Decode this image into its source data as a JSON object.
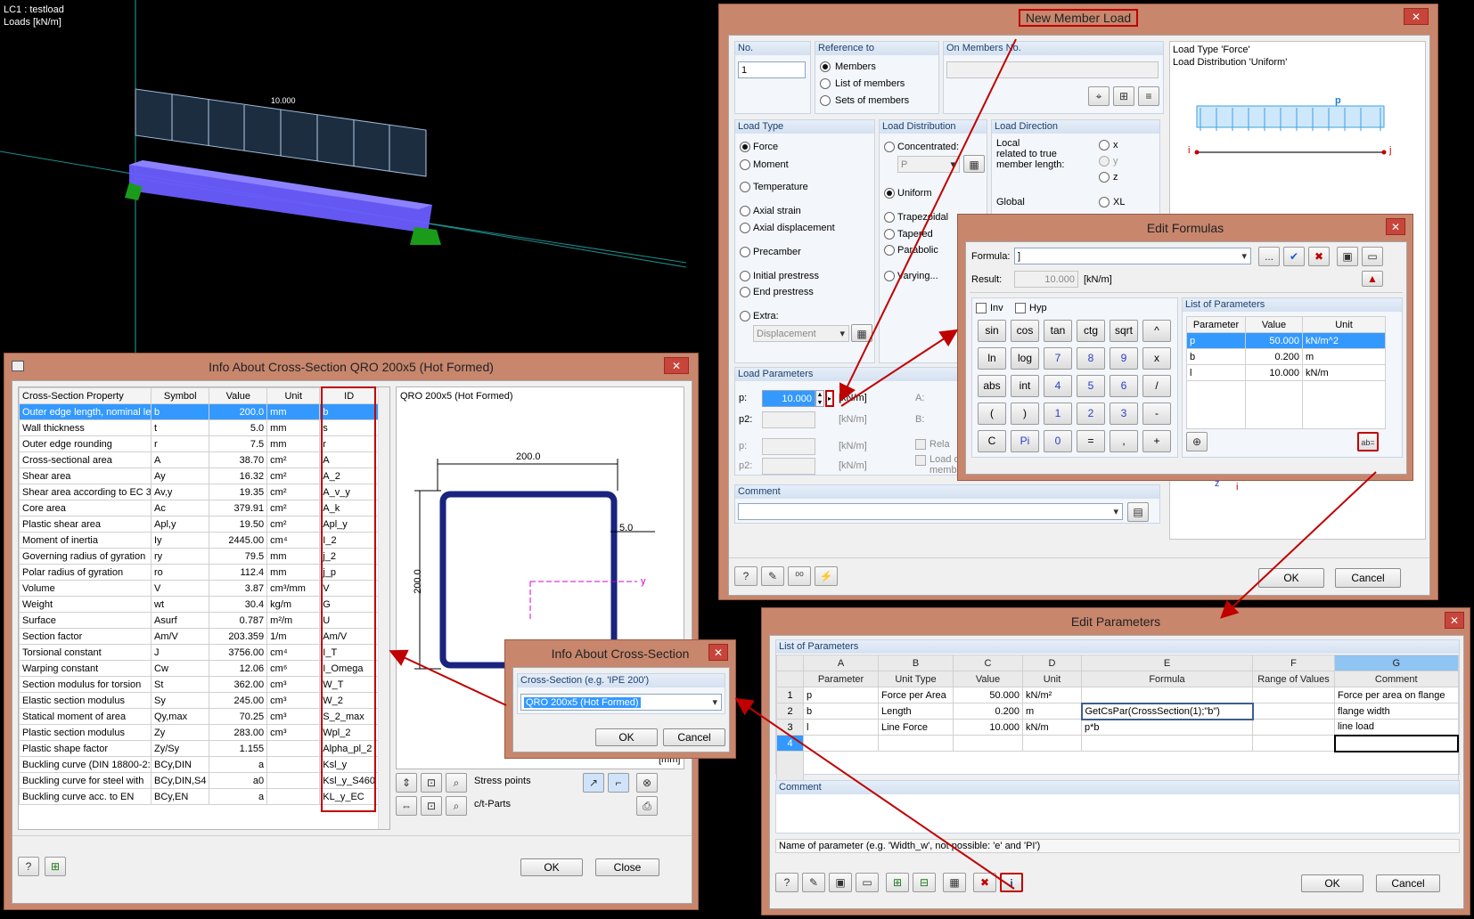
{
  "viewport": {
    "lc_title": "LC1 : testload",
    "loads_label": "Loads [kN/m]",
    "load_value": "10.000"
  },
  "new_member_load": {
    "title": "New Member Load",
    "no_label": "No.",
    "no_value": "1",
    "reference_label": "Reference to",
    "reference_options": [
      "Members",
      "List of members",
      "Sets of members"
    ],
    "on_members_label": "On Members No.",
    "info_text_1": "Load Type 'Force'",
    "info_text_2": "Load Distribution 'Uniform'",
    "diagram_p": "p",
    "diagram_i": "i",
    "diagram_j": "j",
    "load_type_label": "Load Type",
    "load_types": [
      "Force",
      "Moment",
      "Temperature",
      "Axial strain",
      "Axial displacement",
      "Precamber",
      "Initial prestress",
      "End prestress",
      "Extra:"
    ],
    "extra_value": "Displacement",
    "load_dist_label": "Load Distribution",
    "load_dists": [
      "Concentrated:",
      "Uniform",
      "Trapezoidal",
      "Tapered",
      "Parabolic",
      "Varying..."
    ],
    "conc_value": "P",
    "load_dir_label": "Load Direction",
    "local_text": "Local\nrelated to true\nmember length:",
    "dir_local": [
      "x",
      "y",
      "z"
    ],
    "global_label": "Global",
    "dir_global": [
      "XL"
    ],
    "load_params_label": "Load Parameters",
    "p_label": "p:",
    "p_value": "10.000",
    "p2_label": "p2:",
    "unit_knm": "[kN/m]",
    "a_label": "A:",
    "b_label": "B:",
    "rel_label": "Rela",
    "load_over_text": "Load over total length of\nmember",
    "comment_label": "Comment",
    "ok": "OK",
    "cancel": "Cancel",
    "axis_z": "z",
    "axis_i": "i"
  },
  "edit_formulas": {
    "title": "Edit Formulas",
    "formula_label": "Formula:",
    "formula_value": "]",
    "dots": "...",
    "result_label": "Result:",
    "result_value": "10.000",
    "result_unit": "[kN/m]",
    "inv_label": "Inv",
    "hyp_label": "Hyp",
    "keys": [
      [
        "sin",
        "cos",
        "tan",
        "ctg",
        "sqrt",
        "^"
      ],
      [
        "ln",
        "log",
        "7",
        "8",
        "9",
        "x"
      ],
      [
        "abs",
        "int",
        "4",
        "5",
        "6",
        "/"
      ],
      [
        "(",
        ")",
        "1",
        "2",
        "3",
        "-"
      ],
      [
        "C",
        "Pi",
        "0",
        "=",
        ",",
        "+"
      ]
    ],
    "list_title": "List of Parameters",
    "list_headers": [
      "Parameter",
      "Value",
      "Unit"
    ],
    "list_rows": [
      {
        "param": "p",
        "value": "50.000",
        "unit": "kN/m^2"
      },
      {
        "param": "b",
        "value": "0.200",
        "unit": "m"
      },
      {
        "param": "l",
        "value": "10.000",
        "unit": "kN/m"
      }
    ]
  },
  "cross_section": {
    "title": "Info About Cross-Section QRO 200x5 (Hot Formed)",
    "headers": [
      "Cross-Section Property",
      "Symbol",
      "Value",
      "Unit",
      "ID"
    ],
    "rows": [
      [
        "Outer edge length, nominal le",
        "b",
        "200.0",
        "mm",
        "b"
      ],
      [
        "Wall thickness",
        "t",
        "5.0",
        "mm",
        "s"
      ],
      [
        "Outer edge rounding",
        "r",
        "7.5",
        "mm",
        "r"
      ],
      [
        "Cross-sectional area",
        "A",
        "38.70",
        "cm²",
        "A"
      ],
      [
        "Shear area",
        "Ay",
        "16.32",
        "cm²",
        "A_2"
      ],
      [
        "Shear area according to EC 3",
        "Av,y",
        "19.35",
        "cm²",
        "A_v_y"
      ],
      [
        "Core area",
        "Ac",
        "379.91",
        "cm²",
        "A_k"
      ],
      [
        "Plastic shear area",
        "Apl,y",
        "19.50",
        "cm²",
        "Apl_y"
      ],
      [
        "Moment of inertia",
        "Iy",
        "2445.00",
        "cm⁴",
        "I_2"
      ],
      [
        "Governing radius of gyration",
        "ry",
        "79.5",
        "mm",
        "j_2"
      ],
      [
        "Polar radius of gyration",
        "ro",
        "112.4",
        "mm",
        "j_p"
      ],
      [
        "Volume",
        "V",
        "3.87",
        "cm³/mm",
        "V"
      ],
      [
        "Weight",
        "wt",
        "30.4",
        "kg/m",
        "G"
      ],
      [
        "Surface",
        "Asurf",
        "0.787",
        "m²/m",
        "U"
      ],
      [
        "Section factor",
        "Am/V",
        "203.359",
        "1/m",
        "Am/V"
      ],
      [
        "Torsional constant",
        "J",
        "3756.00",
        "cm⁴",
        "I_T"
      ],
      [
        "Warping constant",
        "Cw",
        "12.06",
        "cm⁶",
        "I_Omega"
      ],
      [
        "Section modulus for torsion",
        "St",
        "362.00",
        "cm³",
        "W_T"
      ],
      [
        "Elastic section modulus",
        "Sy",
        "245.00",
        "cm³",
        "W_2"
      ],
      [
        "Statical moment of area",
        "Qy,max",
        "70.25",
        "cm³",
        "S_2_max"
      ],
      [
        "Plastic section modulus",
        "Zy",
        "283.00",
        "cm³",
        "Wpl_2"
      ],
      [
        "Plastic shape factor",
        "Zy/Sy",
        "1.155",
        "",
        "Alpha_pl_2"
      ],
      [
        "Buckling curve (DIN 18800-2:",
        "BCy,DIN",
        "a",
        "",
        "Ksl_y"
      ],
      [
        "Buckling curve for steel with",
        "BCy,DIN,S4",
        "a0",
        "",
        "Ksl_y_S460"
      ],
      [
        "Buckling curve acc. to EN",
        "BCy,EN",
        "a",
        "",
        "KL_y_EC"
      ]
    ],
    "preview_title": "QRO 200x5 (Hot Formed)",
    "dim_width": "200.0",
    "dim_height": "200.0",
    "dim_thk": "5.0",
    "axis_y": "y",
    "unit_mm": "[mm]",
    "stress_points": "Stress points",
    "ct_parts": "c/t-Parts",
    "ok": "OK",
    "close": "Close"
  },
  "info_cs": {
    "title": "Info About Cross-Section",
    "group_label": "Cross-Section (e.g. 'IPE 200')",
    "value": "QRO 200x5 (Hot Formed)",
    "ok": "OK",
    "cancel": "Cancel"
  },
  "edit_parameters": {
    "title": "Edit Parameters",
    "list_title": "List of Parameters",
    "col_letters": [
      "A",
      "B",
      "C",
      "D",
      "E",
      "F",
      "G"
    ],
    "headers": [
      "Parameter",
      "Unit Type",
      "Value",
      "Unit",
      "Formula",
      "Range of Values",
      "Comment"
    ],
    "rows": [
      {
        "n": "1",
        "param": "p",
        "type": "Force per Area",
        "value": "50.000",
        "unit": "kN/m²",
        "formula": "",
        "range": "",
        "comment": "Force per area on flange"
      },
      {
        "n": "2",
        "param": "b",
        "type": "Length",
        "value": "0.200",
        "unit": "m",
        "formula": "GetCsPar(CrossSection(1);\"b\")",
        "range": "",
        "comment": "flange width"
      },
      {
        "n": "3",
        "param": "l",
        "type": "Line Force",
        "value": "10.000",
        "unit": "kN/m",
        "formula": "p*b",
        "range": "",
        "comment": "line load"
      },
      {
        "n": "4",
        "param": "",
        "type": "",
        "value": "",
        "unit": "",
        "formula": "",
        "range": "",
        "comment": ""
      }
    ],
    "comment_label": "Comment",
    "hint": "Name of parameter (e.g. 'Width_w', not possible: 'e' and 'PI')",
    "ok": "OK",
    "cancel": "Cancel"
  },
  "colors": {
    "title_bar": "#c8866d",
    "close": "#c7453b",
    "selection": "#3399ff",
    "beam": "#6a5cff",
    "arrow": "#c00000"
  }
}
